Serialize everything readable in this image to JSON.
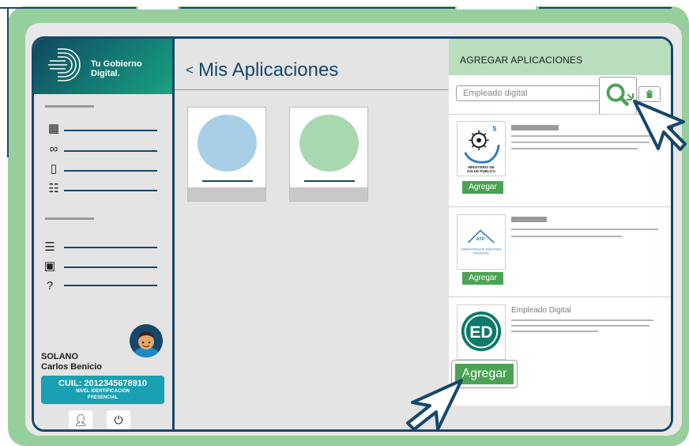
{
  "brand": {
    "line1": "Tu Gobierno",
    "line2": "Digital."
  },
  "user": {
    "last_name": "SOLANO",
    "first_name": "Carlos Benicio",
    "cuil": "CUIL: 2012345678910",
    "level_line1": "NIVEL IDENTIFICACIÓN",
    "level_line2": "PRESENCIAL"
  },
  "sidebar": {
    "menu_icons": [
      "grid-icon",
      "link-icon",
      "door-icon",
      "document-icon",
      "receipt-icon",
      "book-info-icon",
      "question-icon"
    ]
  },
  "main": {
    "back_label": "<",
    "title": "Mis Aplicaciones",
    "apps": [
      {
        "color": "#a9cfe7"
      },
      {
        "color": "#a8d8b0"
      }
    ]
  },
  "panel": {
    "title": "AGREGAR APLICACIONES",
    "search_value": "Empleado digital",
    "results": [
      {
        "logo_caption_1": "MINISTERIO DE",
        "logo_caption_2": "SALUD PÚBLICA",
        "button": "Agregar"
      },
      {
        "logo_badge": "ATP",
        "logo_caption_1": "ADMINISTRACIÓN TRIBUTARIA",
        "logo_caption_2": "PROVINCIAL",
        "button": "Agregar"
      },
      {
        "name": "Empleado Digital",
        "logo_text": "ED",
        "button": "Agregar"
      }
    ]
  },
  "colors": {
    "accent": "#15476b",
    "green": "#4aa353",
    "teal": "#1aa0b3",
    "frame": "#97cf9c"
  }
}
